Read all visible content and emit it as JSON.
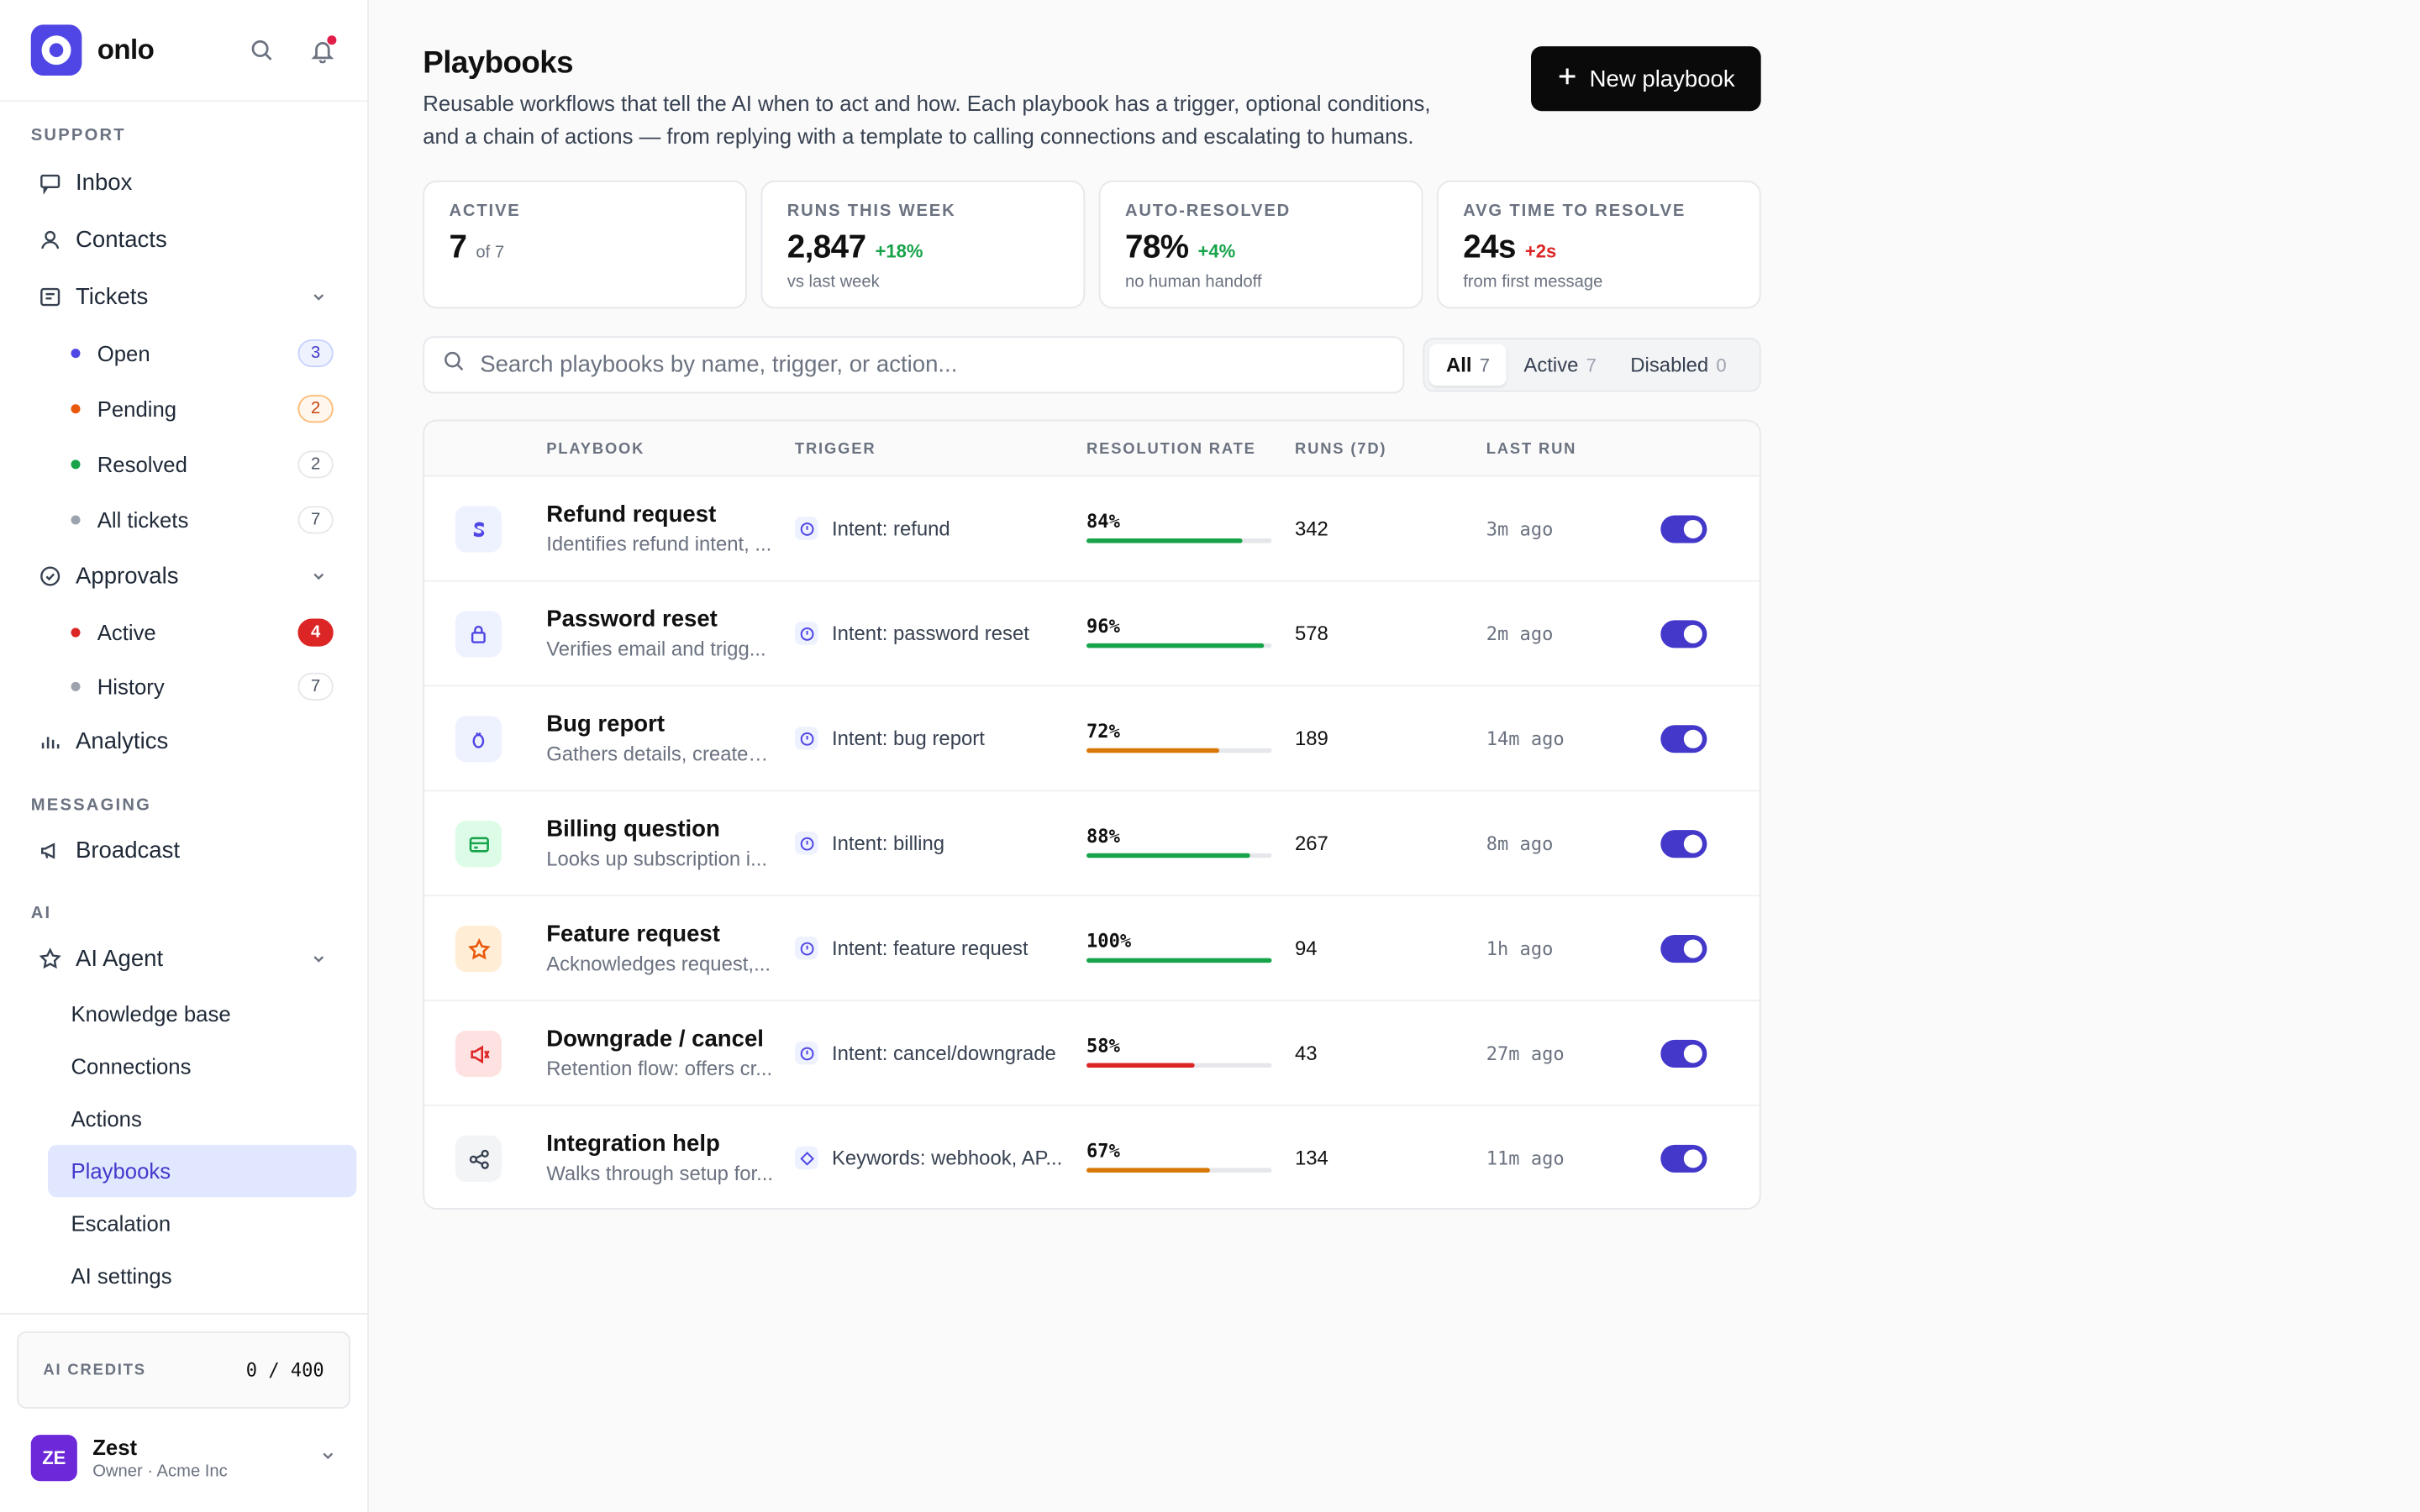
{
  "brand": {
    "name": "onlo"
  },
  "sidebar": {
    "support_label": "SUPPORT",
    "inbox": "Inbox",
    "contacts": "Contacts",
    "tickets": "Tickets",
    "ticket_items": [
      {
        "label": "Open",
        "count": "3",
        "color": "#4f46e5"
      },
      {
        "label": "Pending",
        "count": "2",
        "color": "#ea580c"
      },
      {
        "label": "Resolved",
        "count": "2",
        "color": "#16a34a"
      },
      {
        "label": "All tickets",
        "count": "7",
        "color": "#9ca3af"
      }
    ],
    "approvals": "Approvals",
    "approval_items": [
      {
        "label": "Active",
        "count": "4",
        "color": "#dc2626"
      },
      {
        "label": "History",
        "count": "7",
        "color": "#9ca3af"
      }
    ],
    "analytics": "Analytics",
    "messaging_label": "MESSAGING",
    "broadcast": "Broadcast",
    "ai_label": "AI",
    "ai_agent": "AI Agent",
    "ai_items": [
      "Knowledge base",
      "Connections",
      "Actions",
      "Playbooks",
      "Escalation",
      "AI settings"
    ],
    "active_item": "Playbooks",
    "credits_label": "AI CREDITS",
    "credits_value": "0 / 400",
    "user_initials": "ZE",
    "user_name": "Zest",
    "user_role": "Owner · Acme Inc"
  },
  "header": {
    "title": "Playbooks",
    "description": "Reusable workflows that tell the AI when to act and how. Each playbook has a trigger, optional conditions, and a chain of actions — from replying with a template to calling connections and escalating to humans.",
    "new_button": "New playbook"
  },
  "stats": [
    {
      "label": "ACTIVE",
      "value": "7",
      "delta": "of 7",
      "delta_type": "muted",
      "sub": ""
    },
    {
      "label": "RUNS THIS WEEK",
      "value": "2,847",
      "delta": "+18%",
      "delta_type": "pos",
      "sub": "vs last week"
    },
    {
      "label": "AUTO-RESOLVED",
      "value": "78%",
      "delta": "+4%",
      "delta_type": "pos",
      "sub": "no human handoff"
    },
    {
      "label": "AVG TIME TO RESOLVE",
      "value": "24s",
      "delta": "+2s",
      "delta_type": "neg",
      "sub": "from first message"
    }
  ],
  "search": {
    "placeholder": "Search playbooks by name, trigger, or action..."
  },
  "filters": [
    {
      "label": "All",
      "count": "7"
    },
    {
      "label": "Active",
      "count": "7"
    },
    {
      "label": "Disabled",
      "count": "0"
    }
  ],
  "table": {
    "headers": {
      "playbook": "PLAYBOOK",
      "trigger": "TRIGGER",
      "rate": "RESOLUTION RATE",
      "runs": "RUNS (7D)",
      "last": "LAST RUN"
    },
    "rows": [
      {
        "icon": "stripe-icon",
        "icon_bg": "#eef2ff",
        "icon_color": "#4f46e5",
        "name": "Refund request",
        "desc": "Identifies refund intent, ...",
        "trigger_icon": "intent-icon",
        "trigger": "Intent: refund",
        "rate": "84%",
        "rate_pct": 84,
        "rate_color": "#16a34a",
        "runs": "342",
        "last": "3m ago",
        "enabled": true
      },
      {
        "icon": "lock-icon",
        "icon_bg": "#eef2ff",
        "icon_color": "#4f46e5",
        "name": "Password reset",
        "desc": "Verifies email and trigg...",
        "trigger_icon": "intent-icon",
        "trigger": "Intent: password reset",
        "rate": "96%",
        "rate_pct": 96,
        "rate_color": "#16a34a",
        "runs": "578",
        "last": "2m ago",
        "enabled": true
      },
      {
        "icon": "bug-icon",
        "icon_bg": "#eef2ff",
        "icon_color": "#4f46e5",
        "name": "Bug report",
        "desc": "Gathers details, creates...",
        "trigger_icon": "intent-icon",
        "trigger": "Intent: bug report",
        "rate": "72%",
        "rate_pct": 72,
        "rate_color": "#d97706",
        "runs": "189",
        "last": "14m ago",
        "enabled": true
      },
      {
        "icon": "card-icon",
        "icon_bg": "#dcfce7",
        "icon_color": "#16a34a",
        "name": "Billing question",
        "desc": "Looks up subscription i...",
        "trigger_icon": "intent-icon",
        "trigger": "Intent: billing",
        "rate": "88%",
        "rate_pct": 88,
        "rate_color": "#16a34a",
        "runs": "267",
        "last": "8m ago",
        "enabled": true
      },
      {
        "icon": "star-icon",
        "icon_bg": "#ffedd5",
        "icon_color": "#ea580c",
        "name": "Feature request",
        "desc": "Acknowledges request,...",
        "trigger_icon": "intent-icon",
        "trigger": "Intent: feature request",
        "rate": "100%",
        "rate_pct": 100,
        "rate_color": "#16a34a",
        "runs": "94",
        "last": "1h ago",
        "enabled": true
      },
      {
        "icon": "megaphone-off-icon",
        "icon_bg": "#fee2e2",
        "icon_color": "#dc2626",
        "name": "Downgrade / cancel",
        "desc": "Retention flow: offers cr...",
        "trigger_icon": "intent-icon",
        "trigger": "Intent: cancel/downgrade",
        "rate": "58%",
        "rate_pct": 58,
        "rate_color": "#dc2626",
        "runs": "43",
        "last": "27m ago",
        "enabled": true
      },
      {
        "icon": "share-icon",
        "icon_bg": "#f3f4f6",
        "icon_color": "#374151",
        "name": "Integration help",
        "desc": "Walks through setup for...",
        "trigger_icon": "keyword-icon",
        "trigger": "Keywords: webhook, AP...",
        "rate": "67%",
        "rate_pct": 67,
        "rate_color": "#d97706",
        "runs": "134",
        "last": "11m ago",
        "enabled": true
      }
    ]
  }
}
